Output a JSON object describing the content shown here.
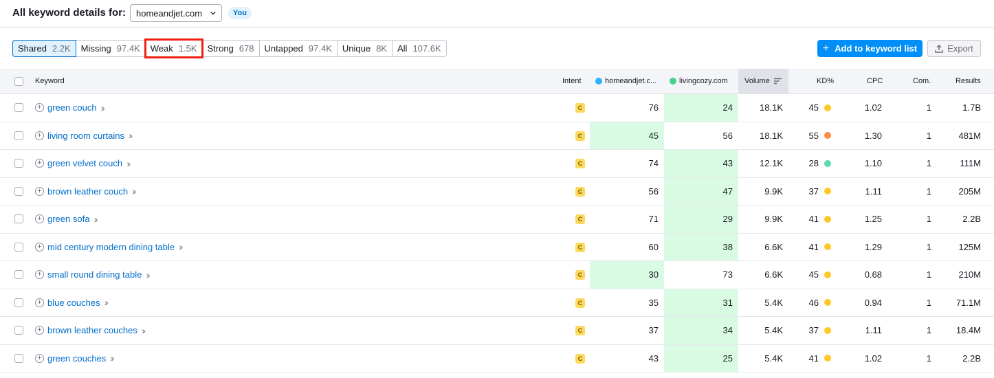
{
  "header": {
    "title": "All keyword details for:",
    "domain": "homeandjet.com",
    "you_badge": "You"
  },
  "tabs": [
    {
      "label": "Shared",
      "count": "2.2K",
      "active": true
    },
    {
      "label": "Missing",
      "count": "97.4K"
    },
    {
      "label": "Weak",
      "count": "1.5K",
      "highlighted": true
    },
    {
      "label": "Strong",
      "count": "678"
    },
    {
      "label": "Untapped",
      "count": "97.4K"
    },
    {
      "label": "Unique",
      "count": "8K"
    },
    {
      "label": "All",
      "count": "107.6K"
    }
  ],
  "actions": {
    "add_label": "Add to keyword list",
    "export_label": "Export"
  },
  "columns": {
    "keyword": "Keyword",
    "intent": "Intent",
    "you": "homeandjet.c...",
    "competitor": "livingcozy.com",
    "volume": "Volume",
    "kd": "KD%",
    "cpc": "CPC",
    "com": "Com.",
    "results": "Results"
  },
  "colors": {
    "you_dot": "#2bb3ff",
    "competitor_dot": "#47d18c",
    "best_cell": "#d9fbe3",
    "highlight": "#ee1f0f",
    "kd_yellow": "#ffc825",
    "kd_orange": "#ff8c43",
    "kd_green": "#59ddaa"
  },
  "rows": [
    {
      "keyword": "green couch",
      "intent": "C",
      "you": "76",
      "comp": "24",
      "best": "comp",
      "volume": "18.1K",
      "kd": "45",
      "kd_color": "#ffc825",
      "cpc": "1.02",
      "com": "1",
      "results": "1.7B"
    },
    {
      "keyword": "living room curtains",
      "intent": "C",
      "you": "45",
      "comp": "56",
      "best": "you",
      "volume": "18.1K",
      "kd": "55",
      "kd_color": "#ff8c43",
      "cpc": "1.30",
      "com": "1",
      "results": "481M"
    },
    {
      "keyword": "green velvet couch",
      "intent": "C",
      "you": "74",
      "comp": "43",
      "best": "comp",
      "volume": "12.1K",
      "kd": "28",
      "kd_color": "#59ddaa",
      "cpc": "1.10",
      "com": "1",
      "results": "111M"
    },
    {
      "keyword": "brown leather couch",
      "intent": "C",
      "you": "56",
      "comp": "47",
      "best": "comp",
      "volume": "9.9K",
      "kd": "37",
      "kd_color": "#ffc825",
      "cpc": "1.11",
      "com": "1",
      "results": "205M"
    },
    {
      "keyword": "green sofa",
      "intent": "C",
      "you": "71",
      "comp": "29",
      "best": "comp",
      "volume": "9.9K",
      "kd": "41",
      "kd_color": "#ffc825",
      "cpc": "1.25",
      "com": "1",
      "results": "2.2B"
    },
    {
      "keyword": "mid century modern dining table",
      "intent": "C",
      "you": "60",
      "comp": "38",
      "best": "comp",
      "volume": "6.6K",
      "kd": "41",
      "kd_color": "#ffc825",
      "cpc": "1.29",
      "com": "1",
      "results": "125M"
    },
    {
      "keyword": "small round dining table",
      "intent": "C",
      "you": "30",
      "comp": "73",
      "best": "you",
      "volume": "6.6K",
      "kd": "45",
      "kd_color": "#ffc825",
      "cpc": "0.68",
      "com": "1",
      "results": "210M"
    },
    {
      "keyword": "blue couches",
      "intent": "C",
      "you": "35",
      "comp": "31",
      "best": "comp",
      "volume": "5.4K",
      "kd": "46",
      "kd_color": "#ffc825",
      "cpc": "0.94",
      "com": "1",
      "results": "71.1M"
    },
    {
      "keyword": "brown leather couches",
      "intent": "C",
      "you": "37",
      "comp": "34",
      "best": "comp",
      "volume": "5.4K",
      "kd": "37",
      "kd_color": "#ffc825",
      "cpc": "1.11",
      "com": "1",
      "results": "18.4M"
    },
    {
      "keyword": "green couches",
      "intent": "C",
      "you": "43",
      "comp": "25",
      "best": "comp",
      "volume": "5.4K",
      "kd": "41",
      "kd_color": "#ffc825",
      "cpc": "1.02",
      "com": "1",
      "results": "2.2B"
    }
  ]
}
